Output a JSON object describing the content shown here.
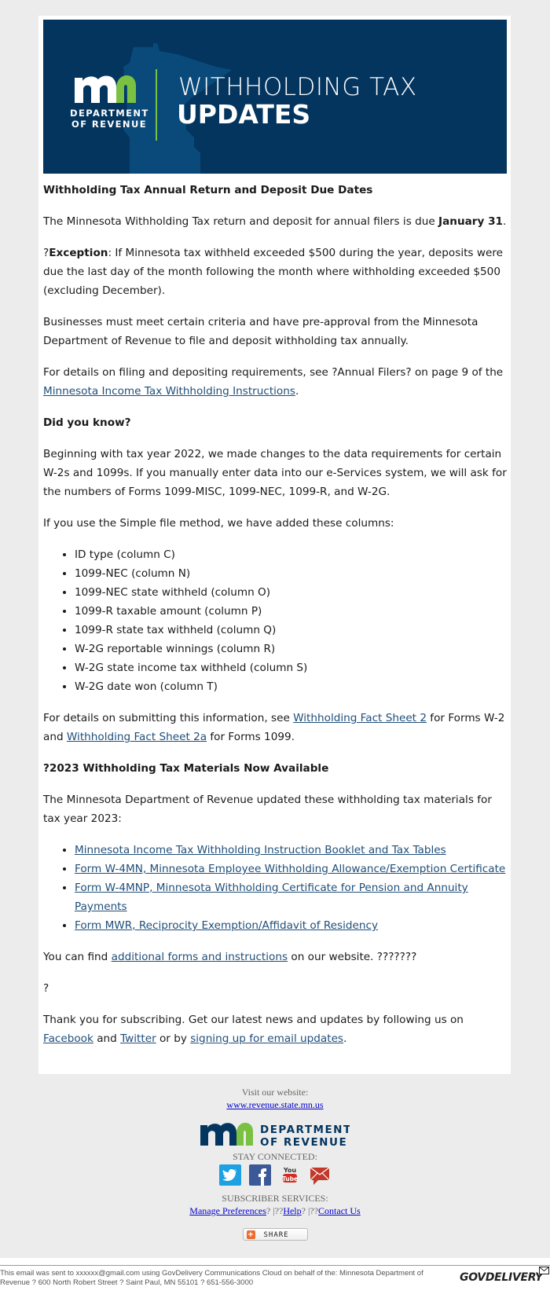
{
  "banner": {
    "logo_text": "mn",
    "dept_line1": "DEPARTMENT",
    "dept_line2": "OF REVENUE",
    "title_line1": "WITHHOLDING TAX",
    "title_line2": "UPDATES",
    "colors": {
      "background": "#03355f",
      "accent": "#7ac143",
      "state_shape": "#0a4a7a"
    }
  },
  "section1": {
    "heading": "Withholding Tax Annual Return and Deposit Due Dates",
    "p1_text": "The Minnesota Withholding Tax return and deposit for annual filers is due ",
    "p1_bold": "January 31",
    "p1_end": ".",
    "p2_prefix": "?",
    "p2_bold": "Exception",
    "p2_text": ": If Minnesota tax withheld exceeded $500 during the year, deposits were due the last day of the month following the month where withholding exceeded $500 (excluding December).",
    "p3": "Businesses must meet certain criteria and have pre-approval from the Minnesota Department of Revenue to file and deposit withholding tax annually.",
    "p4_text": "For details on filing and depositing requirements, see ?Annual Filers? on page 9 of the ",
    "p4_link": "Minnesota Income Tax Withholding Instructions",
    "p4_end": "."
  },
  "section2": {
    "heading": "Did you know?",
    "p1": "Beginning with tax year 2022, we made changes to the data requirements for certain W-2s and 1099s. If you manually enter data into our e-Services system, we will ask for the numbers of Forms 1099-MISC, 1099-NEC, 1099-R, and W-2G.",
    "p2": "If you use the Simple file method, we have added these columns:",
    "columns": [
      "ID type (column C)",
      "1099-NEC (column N)",
      "1099-NEC state withheld (column O)",
      "1099-R taxable amount (column P)",
      "1099-R state tax withheld (column Q)",
      "W-2G reportable winnings (column R)",
      "W-2G state income tax withheld (column S)",
      "W-2G date won (column T)"
    ],
    "p3_text1": "For details on submitting this information, see ",
    "p3_link1": "Withholding Fact Sheet 2",
    "p3_text2": " for Forms W-2 and ",
    "p3_link2": "Withholding Fact Sheet 2a",
    "p3_text3": " for Forms 1099."
  },
  "section3": {
    "heading": "?2023 Withholding Tax Materials Now Available",
    "p1": "The Minnesota Department of Revenue updated these withholding tax materials for tax year 2023:",
    "materials": [
      "Minnesota Income Tax Withholding Instruction Booklet and Tax Tables",
      "Form W-4MN, Minnesota Employee Withholding Allowance/Exemption Certificate",
      "Form W-4MNP, Minnesota Withholding Certificate for Pension and Annuity Payments",
      "Form MWR, Reciprocity Exemption/Affidavit of Residency"
    ],
    "p2_text": "You can find ",
    "p2_link": "additional forms and instructions",
    "p2_end": " on our website. ???????",
    "p3": "?",
    "p4_text1": "Thank you for subscribing. Get our latest news and updates by following us on ",
    "p4_link_facebook": "Facebook",
    "p4_text2": " and ",
    "p4_link_twitter": "Twitter",
    "p4_text3": " or by ",
    "p4_link_signup": "signing up for email updates",
    "p4_end": "."
  },
  "footer": {
    "visit_label": "Visit our website:",
    "website_link": "www.revenue.state.mn.us",
    "logo_dept1": "DEPARTMENT",
    "logo_dept2": "OF REVENUE",
    "stay_connected": "STAY CONNECTED:",
    "social": [
      "twitter-icon",
      "facebook-icon",
      "youtube-icon",
      "email-icon"
    ],
    "subscriber_services": "SUBSCRIBER SERVICES:",
    "manage_preferences": "Manage Preferences",
    "sep1": "? |??",
    "help": "Help",
    "sep2": "? |??",
    "contact_us": "Contact Us",
    "share_label": "SHARE"
  },
  "legal": {
    "text": "This email was sent to xxxxxx@gmail.com using GovDelivery Communications Cloud on behalf of the: Minnesota Department of Revenue ? 600 North Robert Street ? Saint Paul, MN 55101 ? 651-556-3000",
    "brand": "GOVDELIVERY"
  }
}
